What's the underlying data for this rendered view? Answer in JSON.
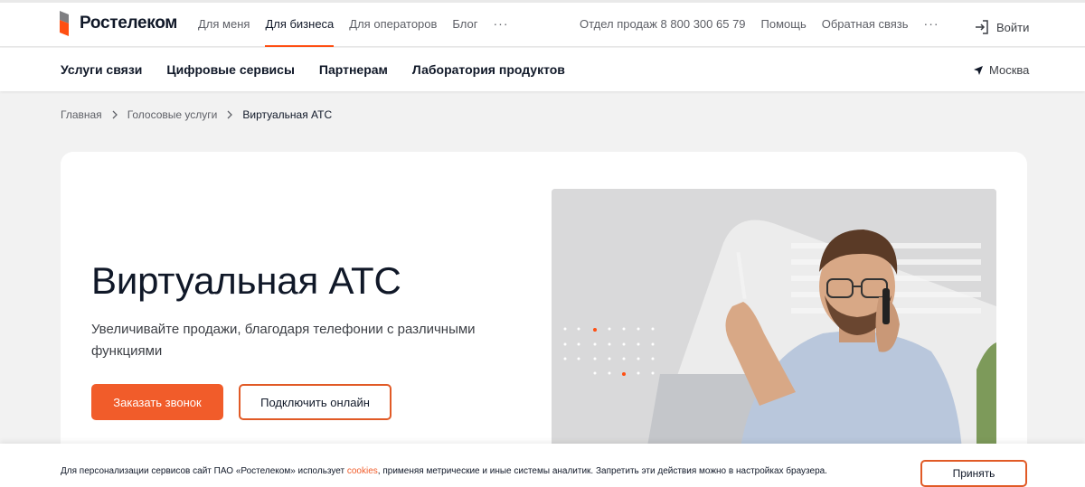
{
  "brand": {
    "name": "Ростелеком",
    "accent": "#ff4f12"
  },
  "topnav": {
    "items": [
      {
        "label": "Для меня"
      },
      {
        "label": "Для бизнеса",
        "active": true
      },
      {
        "label": "Для операторов"
      },
      {
        "label": "Блог"
      }
    ],
    "more": "···"
  },
  "rightnav": {
    "sales": "Отдел продаж 8 800 300 65 79",
    "help": "Помощь",
    "feedback": "Обратная связь",
    "more": "···",
    "login": "Войти"
  },
  "subnav": {
    "items": [
      {
        "label": "Услуги связи"
      },
      {
        "label": "Цифровые сервисы"
      },
      {
        "label": "Партнерам"
      },
      {
        "label": "Лаборатория продуктов"
      }
    ],
    "city": "Москва"
  },
  "breadcrumb": {
    "items": [
      {
        "label": "Главная"
      },
      {
        "label": "Голосовые услуги"
      },
      {
        "label": "Виртуальная АТС"
      }
    ]
  },
  "hero": {
    "title": "Виртуальная АТС",
    "subtitle": "Увеличивайте продажи, благодаря телефонии с различными функциями",
    "primary_button": "Заказать звонок",
    "secondary_button": "Подключить онлайн",
    "image_icon": "man-on-phone-photo"
  },
  "cookie": {
    "text_before": "Для персонализации сервисов сайт ПАО «Ростелеком» использует ",
    "link": "cookies",
    "text_after": ", применяя метрические и иные системы аналитик. Запретить эти действия можно в настройках браузера.",
    "accept": "Принять"
  }
}
